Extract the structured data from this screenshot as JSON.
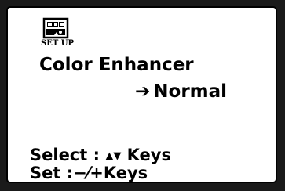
{
  "menu": {
    "setup_label": "SET UP",
    "title": "Color Enhancer",
    "arrow": "➔",
    "selected_option": "Normal"
  },
  "help": {
    "select_prefix": "Select : ",
    "select_up": "▲",
    "select_down": "▼",
    "select_suffix": " Keys",
    "set_text": "Set :−⁄+Keys"
  },
  "icons": {
    "setup": "setup-camera-icon",
    "arrow": "right-arrow-icon"
  }
}
